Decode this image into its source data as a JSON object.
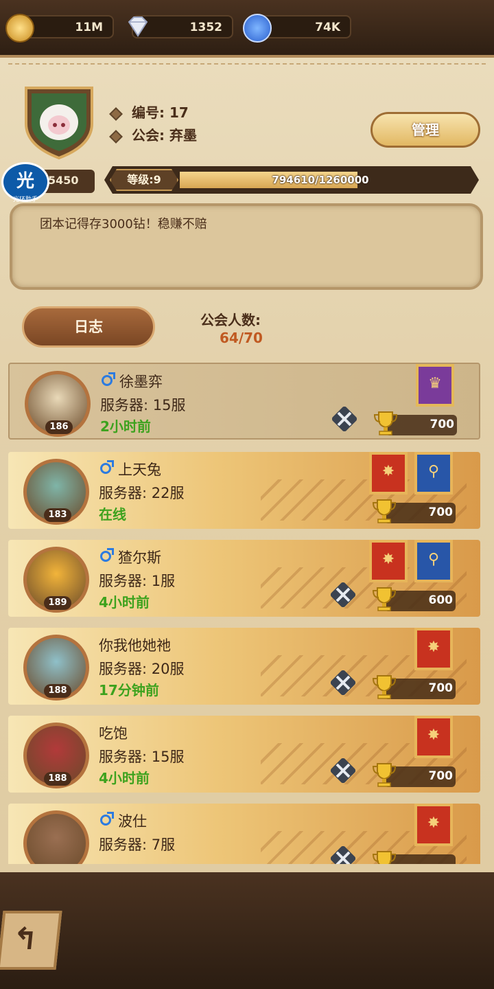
{
  "currency": {
    "gold": "11M",
    "diamonds": "1352",
    "crystals": "74K"
  },
  "guild": {
    "id_label": "编号: 17",
    "name_label": "公会: 弃墨",
    "power": "5450",
    "level_label": "等级:9",
    "exp_text": "794610/1260000",
    "exp_progress": 0.6306,
    "notice": "团本记得存3000钻！稳赚不赔"
  },
  "buttons": {
    "manage": "管理",
    "log": "日志",
    "helper_logo": "光",
    "helper_sub": "光环助手"
  },
  "members_label": "公会人数:",
  "members_count": "64/70",
  "members": [
    {
      "name": "徐墨弈",
      "male": true,
      "server": "服务器: 15服",
      "status": "2小时前",
      "level": "186",
      "trophy": "700",
      "swords": true,
      "banners": [
        "purple"
      ]
    },
    {
      "name": "上天兔",
      "male": true,
      "server": "服务器: 22服",
      "status": "在线",
      "level": "183",
      "trophy": "700",
      "swords": false,
      "banners": [
        "red",
        "blue"
      ]
    },
    {
      "name": "猹尔斯",
      "male": true,
      "server": "服务器: 1服",
      "status": "4小时前",
      "level": "189",
      "trophy": "600",
      "swords": true,
      "banners": [
        "red",
        "blue"
      ]
    },
    {
      "name": "你我他她祂",
      "male": false,
      "server": "服务器: 20服",
      "status": "17分钟前",
      "level": "188",
      "trophy": "700",
      "swords": true,
      "banners": [
        "red"
      ]
    },
    {
      "name": "吃饱",
      "male": false,
      "server": "服务器: 15服",
      "status": "4小时前",
      "level": "188",
      "trophy": "700",
      "swords": true,
      "banners": [
        "red"
      ]
    },
    {
      "name": "波仕",
      "male": true,
      "server": "服务器: 7服",
      "status": "",
      "level": "",
      "trophy": "",
      "swords": true,
      "banners": [
        "red"
      ]
    }
  ],
  "colors": {
    "status_green": "#3da21e",
    "male_blue": "#2c7be0",
    "count_orange": "#c05a22"
  }
}
